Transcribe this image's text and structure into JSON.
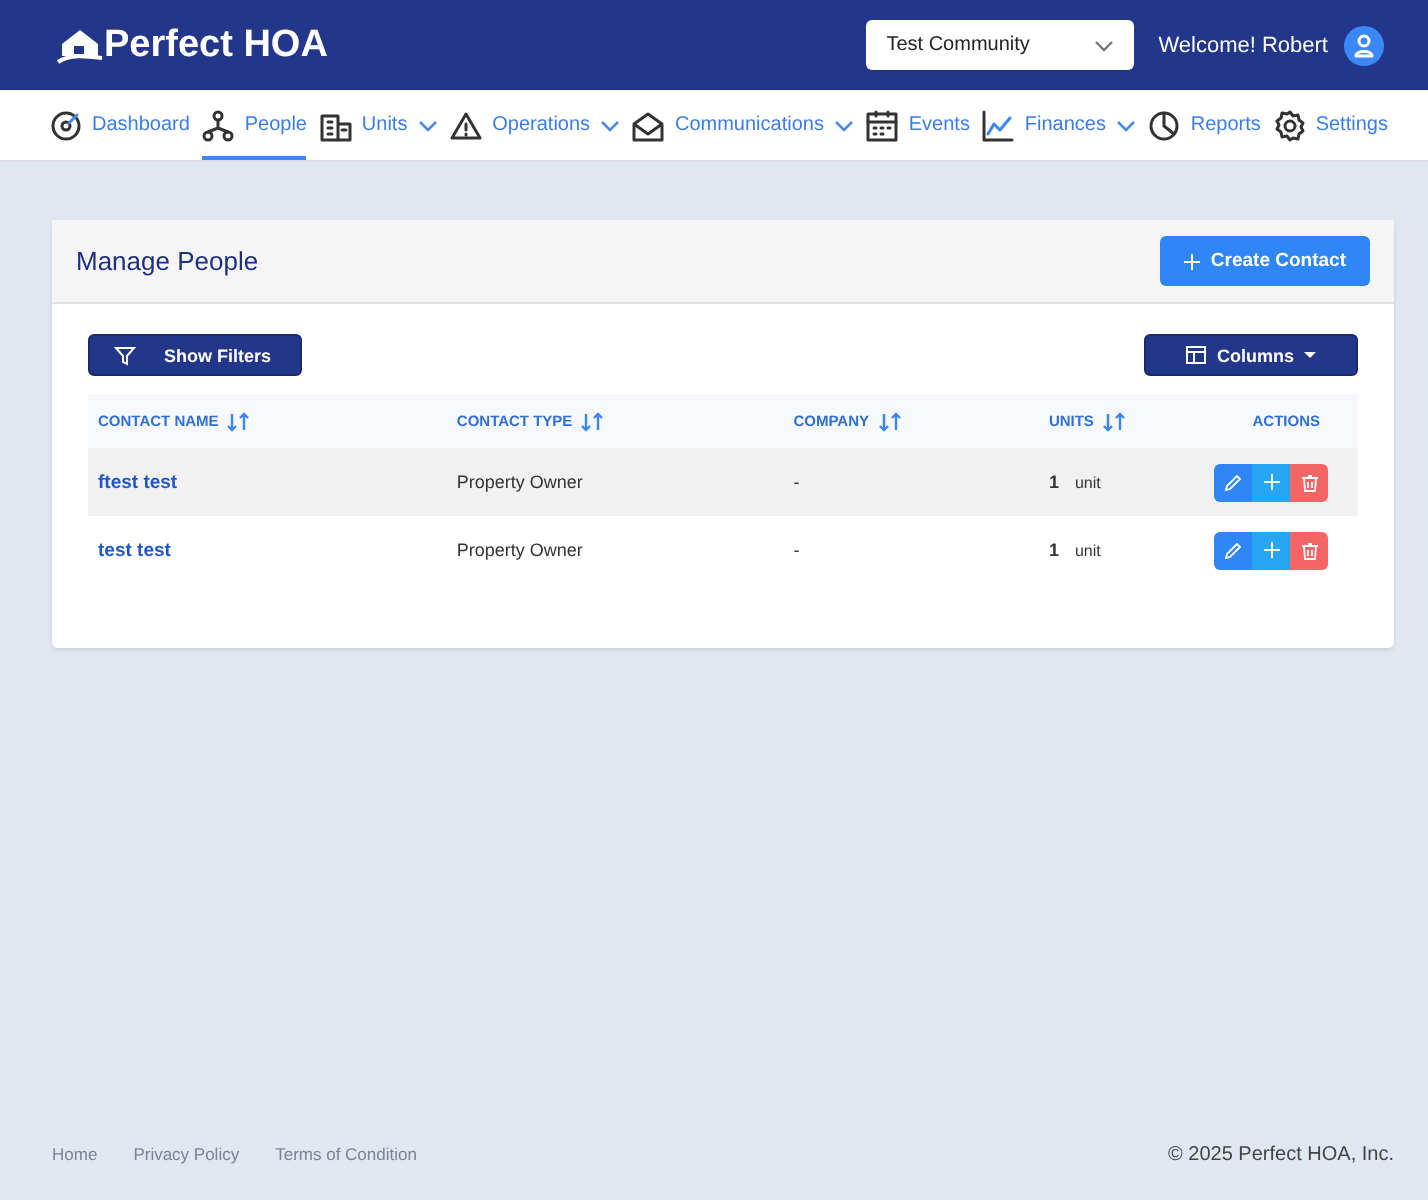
{
  "header": {
    "logo": "Perfect HOA",
    "community_select": {
      "value": "Test Community"
    },
    "welcome": "Welcome! Robert"
  },
  "nav": [
    {
      "label": "Dashboard",
      "selected": false,
      "has_menu": false
    },
    {
      "label": "People",
      "selected": true,
      "has_menu": false
    },
    {
      "label": "Units",
      "selected": false,
      "has_menu": true
    },
    {
      "label": "Operations",
      "selected": false,
      "has_menu": true
    },
    {
      "label": "Communications",
      "selected": false,
      "has_menu": true
    },
    {
      "label": "Events",
      "selected": false,
      "has_menu": false
    },
    {
      "label": "Finances",
      "selected": false,
      "has_menu": true
    },
    {
      "label": "Reports",
      "selected": false,
      "has_menu": false
    },
    {
      "label": "Settings",
      "selected": false,
      "has_menu": false
    }
  ],
  "card": {
    "title": "Manage People",
    "create_button": "Create Contact",
    "filters_button": "Show Filters",
    "columns_button": "Columns",
    "table": {
      "columns": [
        {
          "label": "CONTACT NAME",
          "sortable": true
        },
        {
          "label": "CONTACT TYPE",
          "sortable": true
        },
        {
          "label": "COMPANY",
          "sortable": true
        },
        {
          "label": "UNITS",
          "sortable": true
        },
        {
          "label": "ACTIONS",
          "sortable": false
        }
      ],
      "rows": [
        {
          "name": "ftest test",
          "type": "Property Owner",
          "company": "-",
          "units_count": "1",
          "units_label": "unit",
          "selected": true
        },
        {
          "name": "test test",
          "type": "Property Owner",
          "company": "-",
          "units_count": "1",
          "units_label": "unit",
          "selected": false
        }
      ]
    }
  },
  "footer": {
    "links": [
      "Home",
      "Privacy Policy",
      "Terms of Condition"
    ],
    "copyright": "© 2025 Perfect HOA, Inc."
  }
}
